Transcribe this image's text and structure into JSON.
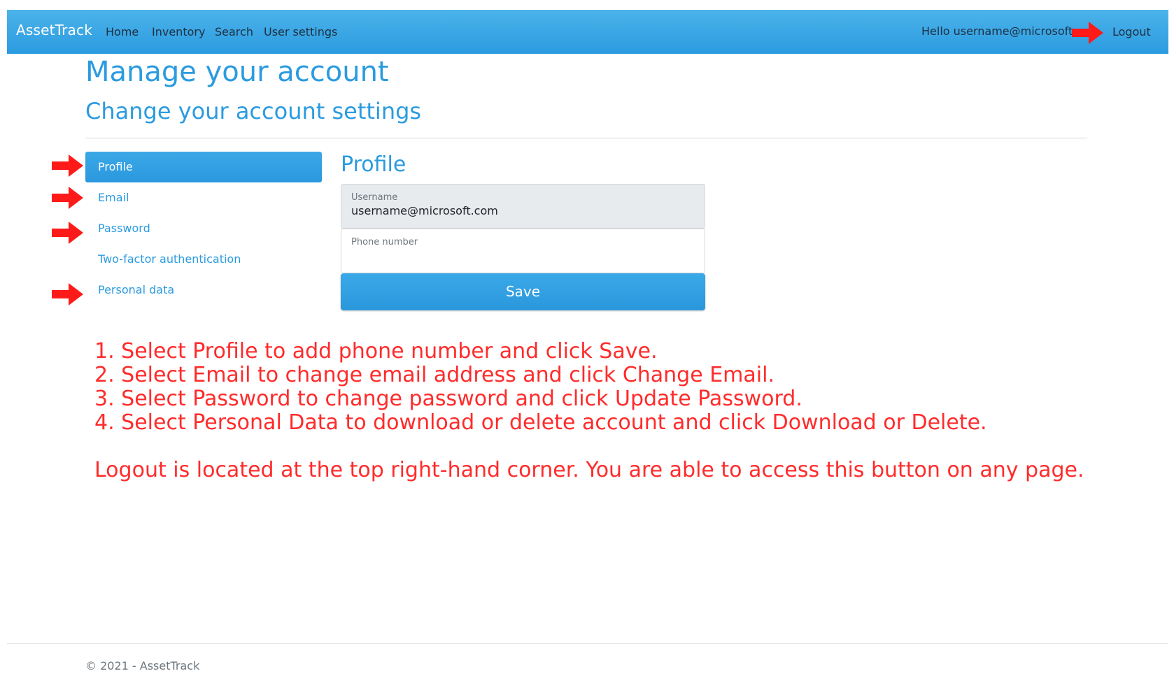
{
  "navbar": {
    "brand": "AssetTrack",
    "links": [
      "Home",
      "Inventory",
      "Search",
      "User settings"
    ],
    "greeting": "Hello username@microsoft.com!",
    "logout": "Logout",
    "bg_color": "#2b9be0"
  },
  "header": {
    "title": "Manage your account",
    "subtitle": "Change your account settings"
  },
  "sidebar": {
    "items": [
      {
        "label": "Profile",
        "active": true
      },
      {
        "label": "Email"
      },
      {
        "label": "Password"
      },
      {
        "label": "Two-factor authentication"
      },
      {
        "label": "Personal data"
      }
    ]
  },
  "profile": {
    "title": "Profile",
    "username_label": "Username",
    "username_value": "username@microsoft.com",
    "phone_label": "Phone number",
    "phone_value": "",
    "save_label": "Save"
  },
  "instructions": {
    "lines": [
      "1. Select Profile to add phone number and click Save.",
      "2. Select Email to change email address and click Change Email.",
      "3. Select Password to change password and click Update Password.",
      "4. Select Personal Data to download or delete account and click Download or Delete."
    ],
    "note": "Logout is located at the top right-hand corner. You are able to access this button on any page.",
    "color": "#ff2b2b"
  },
  "footer": {
    "text": "© 2021 - AssetTrack"
  },
  "icons": {
    "annotation_arrow": "red-arrow-icon"
  }
}
